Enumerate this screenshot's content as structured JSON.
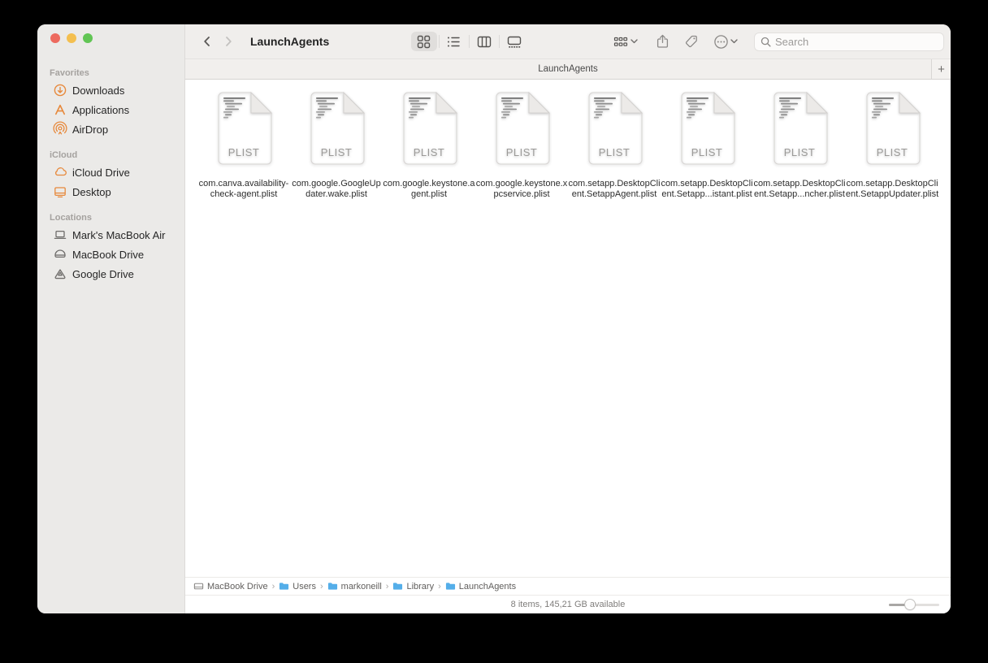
{
  "window": {
    "title": "LaunchAgents"
  },
  "toolbar": {
    "title": "LaunchAgents",
    "search_placeholder": "Search"
  },
  "tabbar": {
    "active_tab": "LaunchAgents",
    "new_tab_label": "+"
  },
  "sidebar": {
    "sections": [
      {
        "title": "Favorites",
        "items": [
          {
            "label": "Downloads",
            "icon": "downloads-icon"
          },
          {
            "label": "Applications",
            "icon": "applications-icon"
          },
          {
            "label": "AirDrop",
            "icon": "airdrop-icon"
          }
        ]
      },
      {
        "title": "iCloud",
        "items": [
          {
            "label": "iCloud Drive",
            "icon": "icloud-drive-icon"
          },
          {
            "label": "Desktop",
            "icon": "desktop-icon"
          }
        ]
      },
      {
        "title": "Locations",
        "items": [
          {
            "label": "Mark's MacBook Air",
            "icon": "laptop-icon"
          },
          {
            "label": "MacBook Drive",
            "icon": "internal-drive-icon"
          },
          {
            "label": "Google Drive",
            "icon": "google-drive-icon"
          }
        ]
      }
    ]
  },
  "files": [
    {
      "badge": "PLIST",
      "line1": "com.canva.availability-",
      "line2": "check-agent.plist"
    },
    {
      "badge": "PLIST",
      "line1": "com.google.GoogleUp",
      "line2": "dater.wake.plist"
    },
    {
      "badge": "PLIST",
      "line1": "com.google.keystone.a",
      "line2": "gent.plist"
    },
    {
      "badge": "PLIST",
      "line1": "com.google.keystone.x",
      "line2": "pcservice.plist"
    },
    {
      "badge": "PLIST",
      "line1": "com.setapp.DesktopCli",
      "line2": "ent.SetappAgent.plist"
    },
    {
      "badge": "PLIST",
      "line1": "com.setapp.DesktopCli",
      "line2": "ent.Setapp...istant.plist"
    },
    {
      "badge": "PLIST",
      "line1": "com.setapp.DesktopCli",
      "line2": "ent.Setapp...ncher.plist"
    },
    {
      "badge": "PLIST",
      "line1": "com.setapp.DesktopCli",
      "line2": "ent.SetappUpdater.plist"
    }
  ],
  "pathbar": {
    "crumbs": [
      {
        "label": "MacBook Drive",
        "icon": "drive-icon"
      },
      {
        "label": "Users",
        "icon": "folder-icon"
      },
      {
        "label": "markoneill",
        "icon": "folder-icon"
      },
      {
        "label": "Library",
        "icon": "folder-icon"
      },
      {
        "label": "LaunchAgents",
        "icon": "folder-icon"
      }
    ],
    "separator": "›"
  },
  "statusbar": {
    "text": "8 items, 145,21 GB available"
  },
  "colors": {
    "accent_orange": "#e7893c",
    "folder_blue": "#54aee9",
    "traffic_red": "#ed6a5e",
    "traffic_yellow": "#f4bf4f",
    "traffic_green": "#61c554",
    "sidebar_bg": "#ebeae8",
    "toolbar_bg": "#f0eeec",
    "selected_view_bg": "#e0dedc"
  }
}
